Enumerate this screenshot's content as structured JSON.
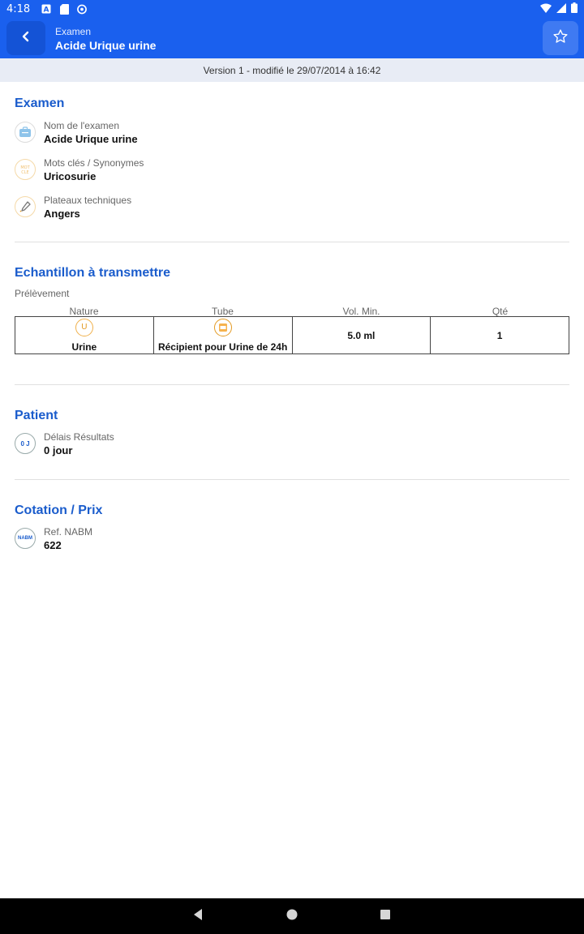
{
  "status_bar": {
    "time": "4:18",
    "left_icons": [
      "a-icon",
      "sd-card-icon",
      "sync-icon"
    ],
    "right_icons": [
      "wifi-icon",
      "cell-signal-icon",
      "battery-icon"
    ]
  },
  "app_bar": {
    "subtitle": "Examen",
    "title": "Acide Urique urine"
  },
  "version_banner": "Version 1 - modifié le 29/07/2014 à 16:42",
  "sections": {
    "examen": {
      "title": "Examen",
      "fields": [
        {
          "label": "Nom de l'examen",
          "value": "Acide Urique urine",
          "icon": "exam-name-icon"
        },
        {
          "label": "Mots clés / Synonymes",
          "value": "Uricosurie",
          "icon": "keywords-icon",
          "icon_text": "MOT CLE"
        },
        {
          "label": "Plateaux techniques",
          "value": "Angers",
          "icon": "pipette-icon"
        }
      ]
    },
    "echantillon": {
      "title": "Echantillon à transmettre",
      "sub_label": "Prélèvement",
      "headers": [
        "Nature",
        "Tube",
        "Vol. Min.",
        "Qté"
      ],
      "row": {
        "nature_icon_text": "U",
        "nature": "Urine",
        "tube": "Récipient pour Urine de 24h",
        "vol_min": "5.0 ml",
        "qte": "1"
      }
    },
    "patient": {
      "title": "Patient",
      "fields": [
        {
          "label": "Délais Résultats",
          "value": "0 jour",
          "icon": "delay-icon",
          "icon_text": "0 J"
        }
      ]
    },
    "cotation": {
      "title": "Cotation / Prix",
      "fields": [
        {
          "label": "Ref. NABM",
          "value": "622",
          "icon": "nabm-icon",
          "icon_text": "NABM"
        }
      ]
    }
  },
  "colors": {
    "primary": "#1a60ee",
    "section_title": "#1a5ccc",
    "banner_bg": "#e8ecf5",
    "accent_orange": "#e39a22"
  }
}
